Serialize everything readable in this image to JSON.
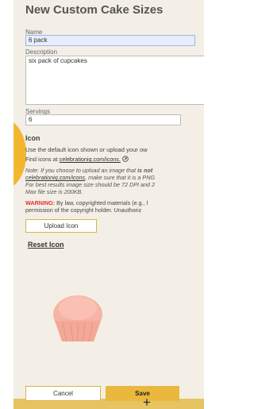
{
  "title": "New Custom Cake Sizes",
  "name": {
    "label": "Name",
    "value": "6 pack"
  },
  "description": {
    "label": "Description",
    "value": "six pack of cupcakes"
  },
  "servings": {
    "label": "Servings",
    "value": "6"
  },
  "icon_section": {
    "heading": "Icon",
    "line1": "Use the default icon shown or upload your ow",
    "find_prefix": "Find icons at ",
    "find_link": "celebrationiq.com/icons.",
    "note_line1_a": "Note: If you choose to upload an image that ",
    "note_line1_b": "is not",
    "note_line2_link": "celebrationiq.com/icons",
    "note_line2_rest": ", make sure that it is a PNG",
    "note_line3": "For best results image size should be 72 DPI and 2",
    "note_line4": "Max file size is 200KB.",
    "warning_label": "WARNING:",
    "warning_line1": " By law, copyrighted materials (e.g., l",
    "warning_line2": "permission of the copyright holder. Unauthoriz"
  },
  "buttons": {
    "upload": "Upload Icon",
    "reset": "Reset Icon",
    "cancel": "Cancel",
    "save": "Save"
  },
  "colors": {
    "accent": "#e9b83d",
    "panel": "#f3efe6",
    "warning": "#d33333",
    "cupcake": "#f7b3a5"
  },
  "icons": {
    "external": "external-link-icon",
    "plus": "plus-icon",
    "cupcake": "cupcake-icon"
  }
}
